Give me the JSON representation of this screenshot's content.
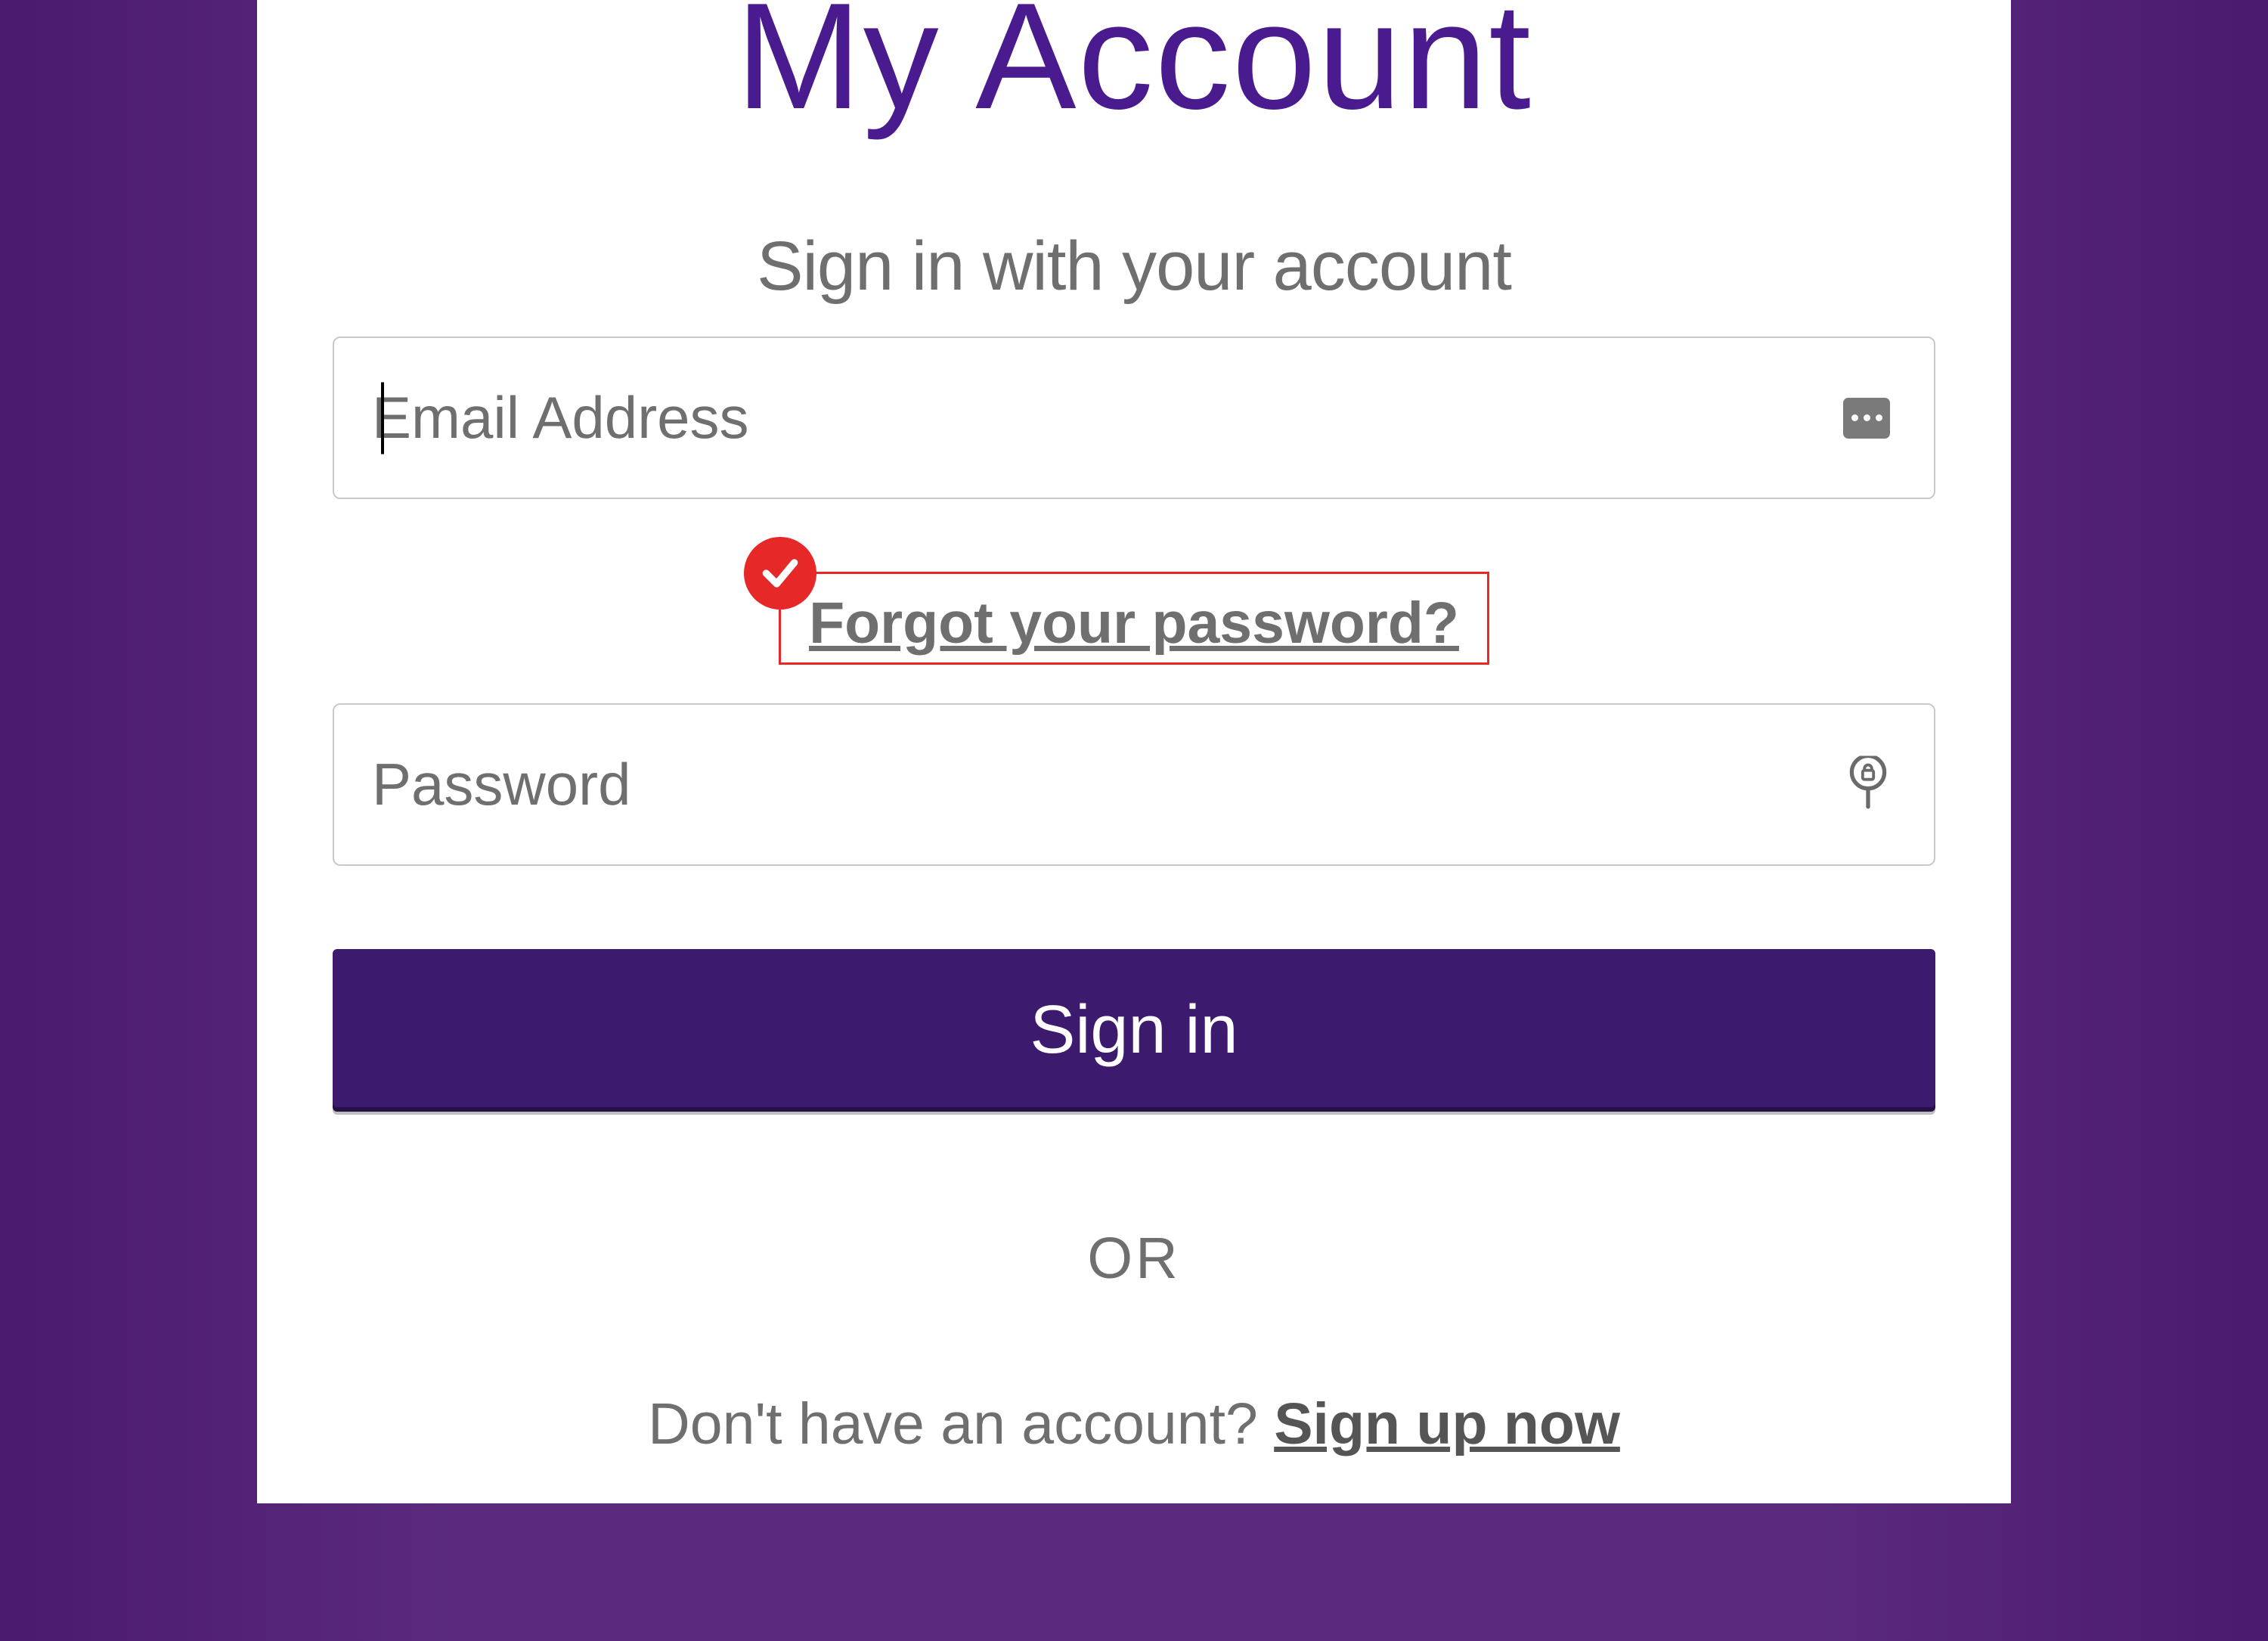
{
  "header": {
    "icon": "lock-icon",
    "title": "My Account",
    "subtitle": "Sign in with your account"
  },
  "form": {
    "email_placeholder": "Email Address",
    "password_placeholder": "Password",
    "forgot_link": "Forgot your password?",
    "submit_label": "Sign in"
  },
  "footer": {
    "or_label": "OR",
    "no_account_prefix": "Don't have an account? ",
    "signup_label": "Sign up now"
  },
  "annotation": {
    "highlight_target": "forgot-password-link",
    "badge": "checkmark"
  },
  "colors": {
    "brand_purple": "#4a1a8f",
    "bg_purple": "#5b2a7f",
    "button_purple": "#3c1a6e",
    "highlight_red": "#e62828",
    "text_gray": "#6f6f6f"
  }
}
